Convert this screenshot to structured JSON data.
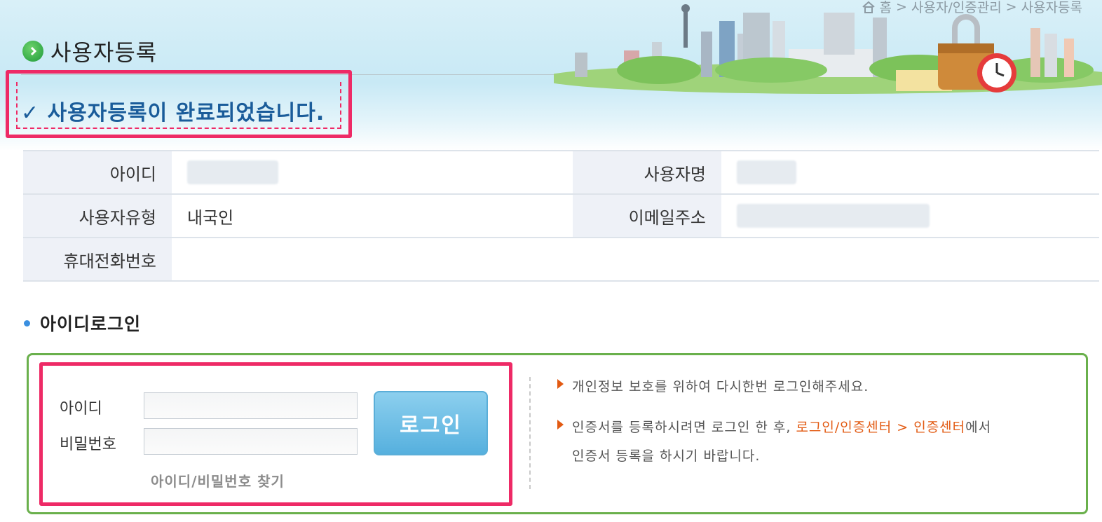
{
  "breadcrumb": {
    "home": "홈",
    "path1": "사용자/인증관리",
    "path2": "사용자등록",
    "sep": ">"
  },
  "page_title": "사용자등록",
  "completion_message": "✓ 사용자등록이 완료되었습니다.",
  "user_info": {
    "id_label": "아이디",
    "id_value": "",
    "name_label": "사용자명",
    "name_value": "",
    "type_label": "사용자유형",
    "type_value": "내국인",
    "email_label": "이메일주소",
    "email_value": "",
    "phone_label": "휴대전화번호",
    "phone_value": ""
  },
  "login_section": {
    "title": "아이디로그인",
    "id_label": "아이디",
    "id_value": "",
    "password_label": "비밀번호",
    "password_value": "",
    "login_button": "로그인",
    "find_link": "아이디/비밀번호 찾기"
  },
  "notices": {
    "notice1": "개인정보 보호를 위하여 다시한번 로그인해주세요.",
    "notice2_prefix": "인증서를 등록하시려면 로그인 한 후, ",
    "notice2_link": "로그인/인증센터 > 인증센터",
    "notice2_suffix": "에서",
    "notice2_line2": "인증서 등록을 하시기 바랍니다."
  },
  "colors": {
    "highlight": "#ee2a66",
    "panel_border": "#6ab04c",
    "button": "#56b0de",
    "message": "#1a5c9a",
    "link_orange": "#e25a12"
  }
}
